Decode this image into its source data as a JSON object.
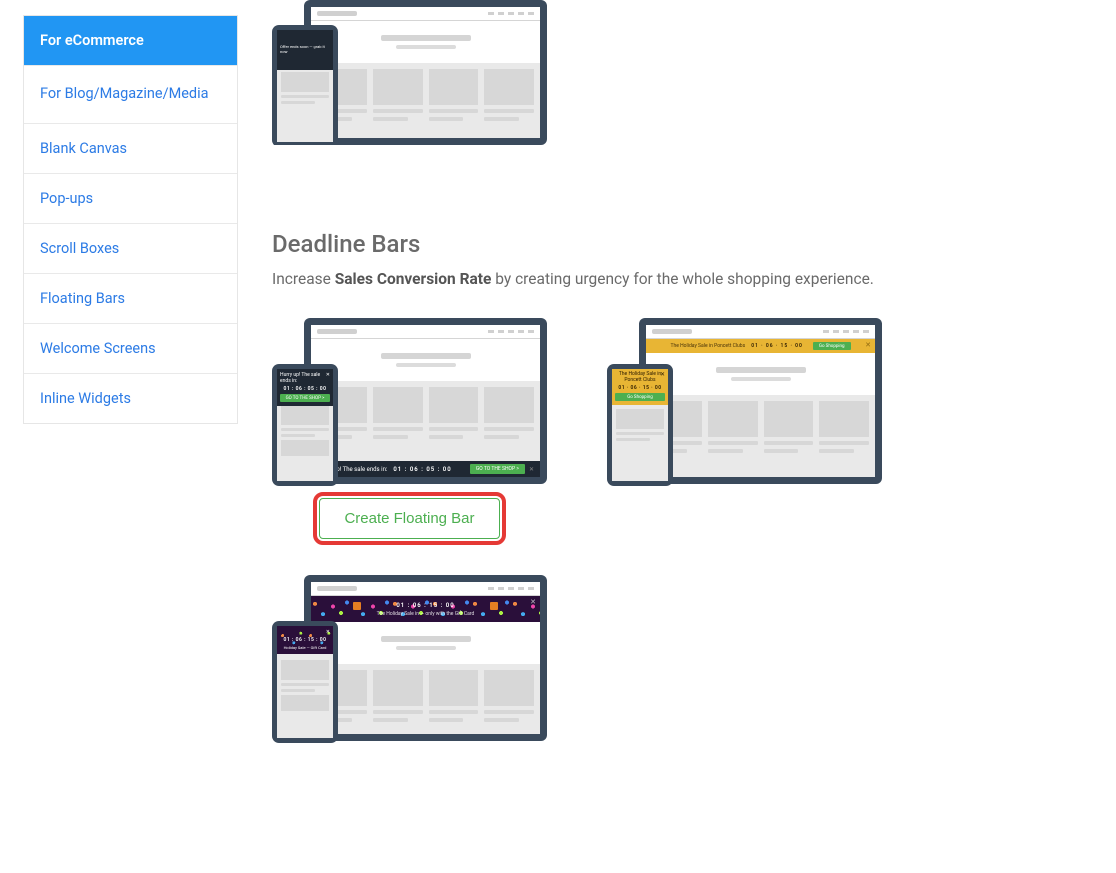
{
  "sidebar": {
    "items": [
      {
        "label": "For eCommerce",
        "active": true
      },
      {
        "label": "For Blog/Magazine/Media"
      },
      {
        "label": "Blank Canvas"
      },
      {
        "label": "Pop-ups"
      },
      {
        "label": "Scroll Boxes"
      },
      {
        "label": "Floating Bars"
      },
      {
        "label": "Welcome Screens"
      },
      {
        "label": "Inline Widgets"
      }
    ]
  },
  "section": {
    "title": "Deadline Bars",
    "desc_a": "Increase ",
    "desc_b": "Sales Conversion Rate",
    "desc_c": " by creating urgency for the whole shopping experience."
  },
  "tpl1": {
    "desk_text": "Hurry up! The sale ends in:",
    "desk_timer": "01 : 06 : 05 : 00",
    "desk_btn": "GO TO THE SHOP >",
    "mob_text": "Hurry up! The sale ends in:",
    "mob_timer": "01 : 06 : 05 : 00",
    "mob_btn": "GO TO THE SHOP >",
    "cta": "Create Floating Bar"
  },
  "tpl2": {
    "desk_text": " The Holiday Sale in Poncett Clubs",
    "desk_timer": "01 · 06 · 15 · 00",
    "desk_btn": "Go Shopping",
    "mob_text": "The Holiday Sale in Poncett Clubs",
    "mob_timer": "01 · 06 · 15 · 00",
    "mob_btn": "Go Shopping"
  },
  "tpl3": {
    "desk_timer": "01 : 06 : 15 : 00",
    "desk_sub": "The Holiday Sale in — only with the Gift Card",
    "mob_timer": "01 : 06 : 15 : 00",
    "mob_sub": "Holiday Sale — Gift Card"
  }
}
